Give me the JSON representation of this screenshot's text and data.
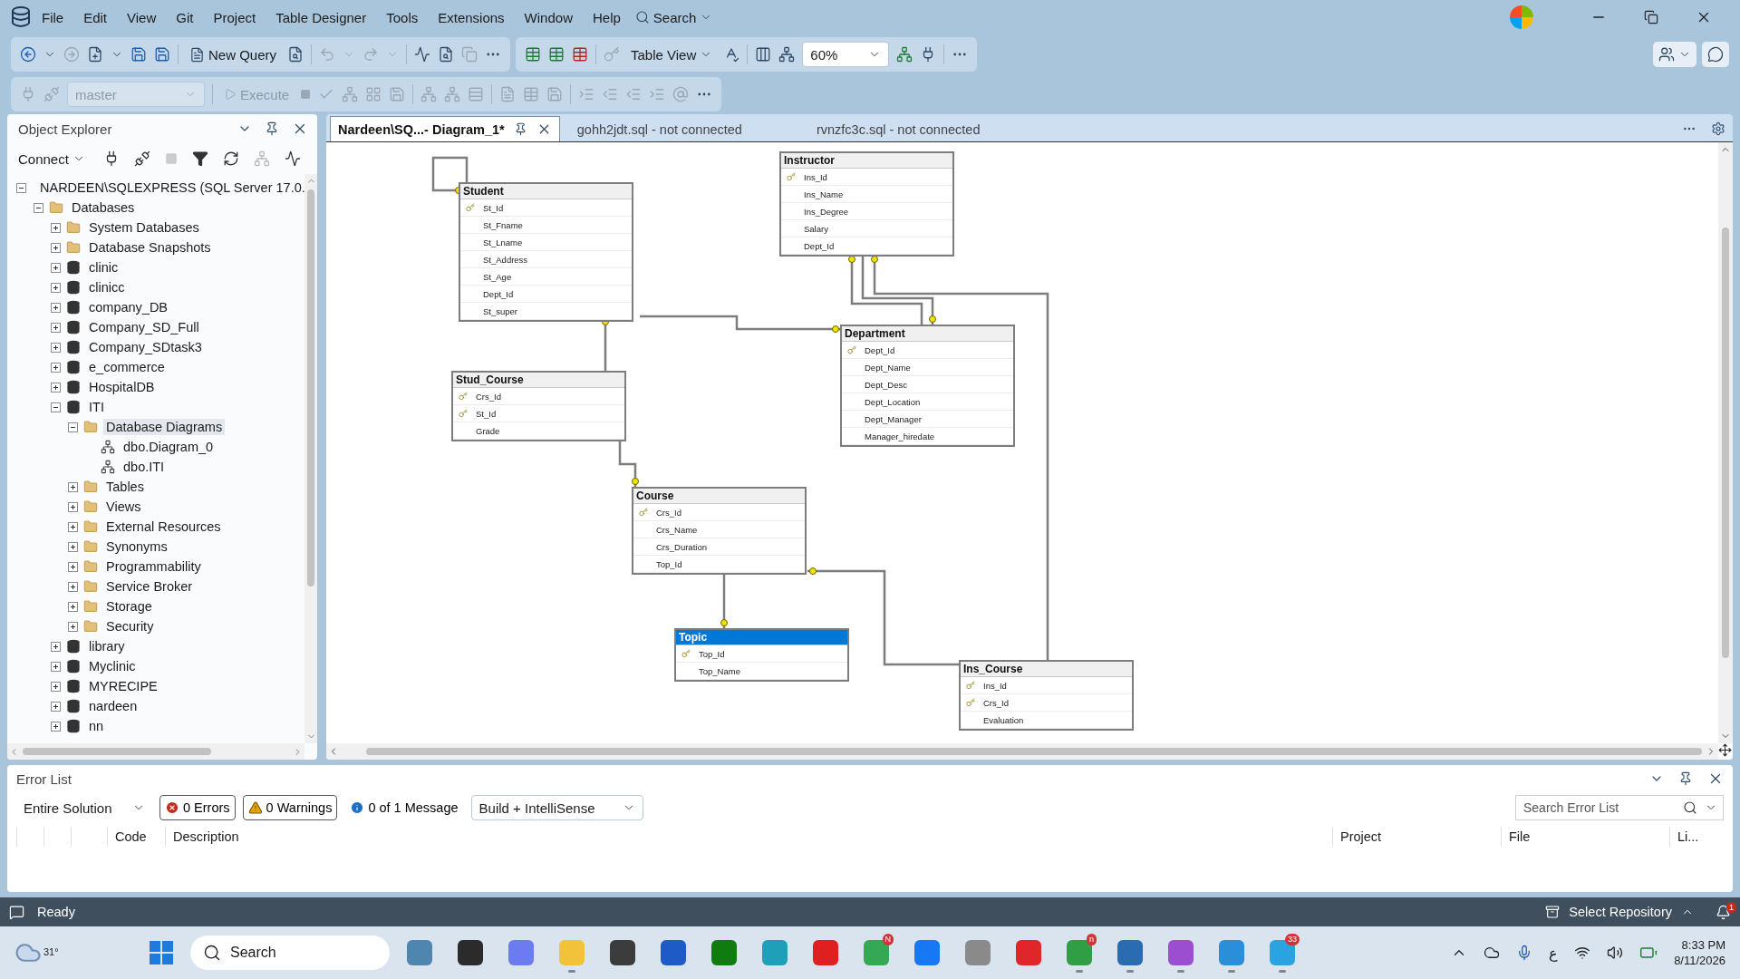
{
  "window": {
    "menu": [
      "File",
      "Edit",
      "View",
      "Git",
      "Project",
      "Table Designer",
      "Tools",
      "Extensions",
      "Window",
      "Help"
    ],
    "search": "Search"
  },
  "toolbar": {
    "new_query": "New Query",
    "view_mode": "Table View",
    "zoom": "60%",
    "database": {
      "value": "master",
      "disabled": true
    },
    "execute": {
      "label": "Execute",
      "disabled": true
    }
  },
  "object_explorer": {
    "title": "Object Explorer",
    "connect": "Connect",
    "tree": [
      {
        "label": "NARDEEN\\SQLEXPRESS (SQL Server 17.0.",
        "kind": "server",
        "expanded": true,
        "selected": false,
        "children": [
          {
            "label": "Databases",
            "kind": "folder",
            "expanded": true,
            "selected": false,
            "children": [
              {
                "label": "System Databases",
                "kind": "folder",
                "expanded": false,
                "selected": false
              },
              {
                "label": "Database Snapshots",
                "kind": "folder",
                "expanded": false,
                "selected": false
              },
              {
                "label": "clinic",
                "kind": "database",
                "expanded": false,
                "selected": false
              },
              {
                "label": "clinicc",
                "kind": "database",
                "expanded": false,
                "selected": false
              },
              {
                "label": "company_DB",
                "kind": "database",
                "expanded": false,
                "selected": false
              },
              {
                "label": "Company_SD_Full",
                "kind": "database",
                "expanded": false,
                "selected": false
              },
              {
                "label": "Company_SDtask3",
                "kind": "database",
                "expanded": false,
                "selected": false
              },
              {
                "label": "e_commerce",
                "kind": "database",
                "expanded": false,
                "selected": false
              },
              {
                "label": "HospitalDB",
                "kind": "database",
                "expanded": false,
                "selected": false
              },
              {
                "label": "ITI",
                "kind": "database",
                "expanded": true,
                "selected": false,
                "children": [
                  {
                    "label": "Database Diagrams",
                    "kind": "folder",
                    "expanded": true,
                    "selected": true,
                    "children": [
                      {
                        "label": "dbo.Diagram_0",
                        "kind": "diagram",
                        "selected": false
                      },
                      {
                        "label": "dbo.ITI",
                        "kind": "diagram",
                        "selected": false
                      }
                    ]
                  },
                  {
                    "label": "Tables",
                    "kind": "folder",
                    "expanded": false,
                    "selected": false
                  },
                  {
                    "label": "Views",
                    "kind": "folder",
                    "expanded": false,
                    "selected": false
                  },
                  {
                    "label": "External Resources",
                    "kind": "folder",
                    "expanded": false,
                    "selected": false
                  },
                  {
                    "label": "Synonyms",
                    "kind": "folder",
                    "expanded": false,
                    "selected": false
                  },
                  {
                    "label": "Programmability",
                    "kind": "folder",
                    "expanded": false,
                    "selected": false
                  },
                  {
                    "label": "Service Broker",
                    "kind": "folder",
                    "expanded": false,
                    "selected": false
                  },
                  {
                    "label": "Storage",
                    "kind": "folder",
                    "expanded": false,
                    "selected": false
                  },
                  {
                    "label": "Security",
                    "kind": "folder",
                    "expanded": false,
                    "selected": false
                  }
                ]
              },
              {
                "label": "library",
                "kind": "database",
                "expanded": false,
                "selected": false
              },
              {
                "label": "Myclinic",
                "kind": "database",
                "expanded": false,
                "selected": false
              },
              {
                "label": "MYRECIPE",
                "kind": "database",
                "expanded": false,
                "selected": false
              },
              {
                "label": "nardeen",
                "kind": "database",
                "expanded": false,
                "selected": false
              },
              {
                "label": "nn",
                "kind": "database",
                "expanded": false,
                "selected": false
              }
            ]
          }
        ]
      }
    ]
  },
  "tabs": [
    {
      "label": "Nardeen\\SQ...- Diagram_1*",
      "selected": true
    },
    {
      "label": "gohh2jdt.sql - not connected",
      "selected": false
    },
    {
      "label": "rvnzfc3c.sql - not connected",
      "selected": false
    }
  ],
  "diagram": {
    "tables": [
      {
        "name": "Instructor",
        "selected": false,
        "columns": [
          {
            "name": "Ins_Id",
            "key": true
          },
          {
            "name": "Ins_Name",
            "key": false
          },
          {
            "name": "Ins_Degree",
            "key": false
          },
          {
            "name": "Salary",
            "key": false
          },
          {
            "name": "Dept_Id",
            "key": false
          }
        ]
      },
      {
        "name": "Student",
        "selected": false,
        "columns": [
          {
            "name": "St_Id",
            "key": true
          },
          {
            "name": "St_Fname",
            "key": false
          },
          {
            "name": "St_Lname",
            "key": false
          },
          {
            "name": "St_Address",
            "key": false
          },
          {
            "name": "St_Age",
            "key": false
          },
          {
            "name": "Dept_Id",
            "key": false
          },
          {
            "name": "St_super",
            "key": false
          }
        ]
      },
      {
        "name": "Department",
        "selected": false,
        "columns": [
          {
            "name": "Dept_Id",
            "key": true
          },
          {
            "name": "Dept_Name",
            "key": false
          },
          {
            "name": "Dept_Desc",
            "key": false
          },
          {
            "name": "Dept_Location",
            "key": false
          },
          {
            "name": "Dept_Manager",
            "key": false
          },
          {
            "name": "Manager_hiredate",
            "key": false
          }
        ]
      },
      {
        "name": "Stud_Course",
        "selected": false,
        "columns": [
          {
            "name": "Crs_Id",
            "key": true
          },
          {
            "name": "St_Id",
            "key": true
          },
          {
            "name": "Grade",
            "key": false
          }
        ]
      },
      {
        "name": "Course",
        "selected": false,
        "columns": [
          {
            "name": "Crs_Id",
            "key": true
          },
          {
            "name": "Crs_Name",
            "key": false
          },
          {
            "name": "Crs_Duration",
            "key": false
          },
          {
            "name": "Top_Id",
            "key": false
          }
        ]
      },
      {
        "name": "Topic",
        "selected": true,
        "columns": [
          {
            "name": "Top_Id",
            "key": true
          },
          {
            "name": "Top_Name",
            "key": false
          }
        ]
      },
      {
        "name": "Ins_Course",
        "selected": false,
        "columns": [
          {
            "name": "Ins_Id",
            "key": true
          },
          {
            "name": "Crs_Id",
            "key": true
          },
          {
            "name": "Evaluation",
            "key": false
          }
        ]
      }
    ]
  },
  "error_list": {
    "title": "Error List",
    "scope": "Entire Solution",
    "errors": {
      "label": "0 Errors",
      "on": true
    },
    "warnings": {
      "label": "0 Warnings",
      "on": true
    },
    "messages": {
      "label": "0 of 1 Message",
      "on": false
    },
    "build": "Build + IntelliSense",
    "search": {
      "placeholder": "Search Error List"
    },
    "columns": [
      "Code",
      "Description",
      "Project",
      "File",
      "Li..."
    ]
  },
  "status_bar": {
    "text": "Ready",
    "repository": "Select Repository",
    "notifications": "1"
  },
  "taskbar": {
    "weather": "31°",
    "search": "Search",
    "apps": [
      {
        "color": "#4f86b0",
        "running": false
      },
      {
        "color": "#2b2b2b",
        "running": false
      },
      {
        "color": "#6b7cf0",
        "running": false
      },
      {
        "color": "#f2c23b",
        "running": true
      },
      {
        "color": "#3c3c3c",
        "running": false
      },
      {
        "color": "#1e5bc6",
        "running": false
      },
      {
        "color": "#107c10",
        "running": false
      },
      {
        "color": "#1fa0b8",
        "running": false
      },
      {
        "color": "#e02020",
        "running": false
      },
      {
        "color": "#34a853",
        "running": false,
        "badge": "N"
      },
      {
        "color": "#1877f2",
        "running": false
      },
      {
        "color": "#8a8a8a",
        "running": false
      },
      {
        "color": "#e0262b",
        "running": false
      },
      {
        "color": "#2f9e44",
        "running": true,
        "badge": "n"
      },
      {
        "color": "#2b6cb0",
        "running": true
      },
      {
        "color": "#9b4fd0",
        "running": true
      },
      {
        "color": "#2a8fd8",
        "running": true
      },
      {
        "color": "#2aa3e0",
        "running": true,
        "badge": "33"
      }
    ],
    "language": "ع",
    "time": "8:33 PM",
    "date": "8/11/2026"
  }
}
